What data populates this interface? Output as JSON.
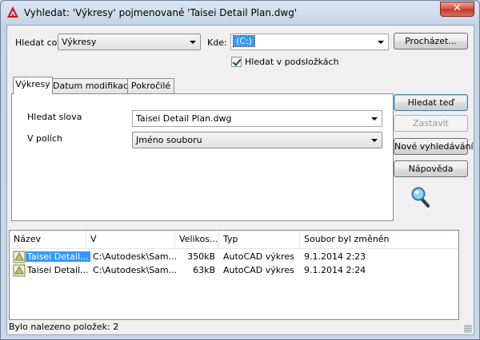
{
  "window": {
    "title": "Vyhledat: 'Výkresy' pojmenované 'Taisei Detail Plan.dwg'",
    "close_glyph": "✕"
  },
  "search": {
    "find_label": "Hledat co:",
    "find_value": "Výkresy",
    "where_label": "Kde:",
    "where_value": "(C:)",
    "browse_button": "Procházet...",
    "subfolders_label": "Hledat v podsložkách",
    "subfolders_checked": true
  },
  "tabs": [
    {
      "label": "Výkresy",
      "active": true
    },
    {
      "label": "Datum modifikace",
      "active": false
    },
    {
      "label": "Pokročilé",
      "active": false
    }
  ],
  "drawings_tab": {
    "words_label": "Hledat slova",
    "words_value": "Taisei Detail Plan.dwg",
    "fields_label": "V polích",
    "fields_value": "Jméno souboru"
  },
  "actions": {
    "find_now": "Hledat teď",
    "stop": "Zastavit",
    "new_search": "Nové vyhledávání",
    "help": "Nápověda"
  },
  "results": {
    "columns": [
      "Název",
      "V",
      "Velikos...",
      "Typ",
      "Soubor byl změněn"
    ],
    "rows": [
      {
        "name": "Taisei Detail...",
        "folder": "C:\\Autodesk\\Sam...",
        "size": "350kB",
        "type": "AutoCAD výkres",
        "modified": "9.1.2014 2:23",
        "selected": true
      },
      {
        "name": "Taisei Detail...",
        "folder": "C:\\Autodesk\\Sam...",
        "size": "63kB",
        "type": "AutoCAD výkres",
        "modified": "9.1.2014 2:24",
        "selected": false
      }
    ]
  },
  "status": {
    "text": "Bylo nalezeno položek: 2"
  },
  "colors": {
    "accent": "#3399ff",
    "autocad_red": "#c4161c",
    "selected_row": "#3399ff"
  }
}
